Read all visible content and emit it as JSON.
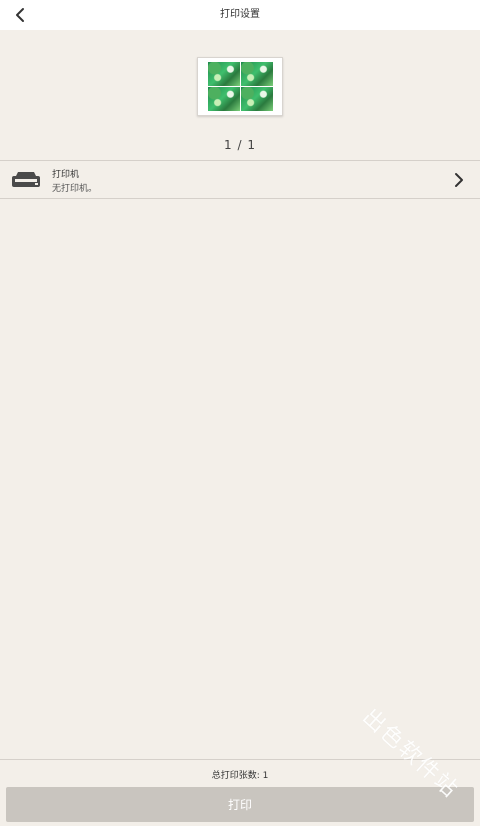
{
  "header": {
    "title": "打印设置",
    "back_icon": "back-arrow-icon"
  },
  "preview": {
    "page_indicator": "1 / 1",
    "image_count": 4
  },
  "printer": {
    "label": "打印机",
    "status": "无打印机。",
    "icon": "printer-icon",
    "chevron_icon": "chevron-right-icon"
  },
  "footer": {
    "total_label": "总打印张数: 1",
    "print_button": "打印"
  },
  "watermark": {
    "text": "出色软件站"
  },
  "colors": {
    "background": "#f3efe9",
    "topbar": "#ffffff",
    "button_disabled": "#c9c5bf"
  }
}
